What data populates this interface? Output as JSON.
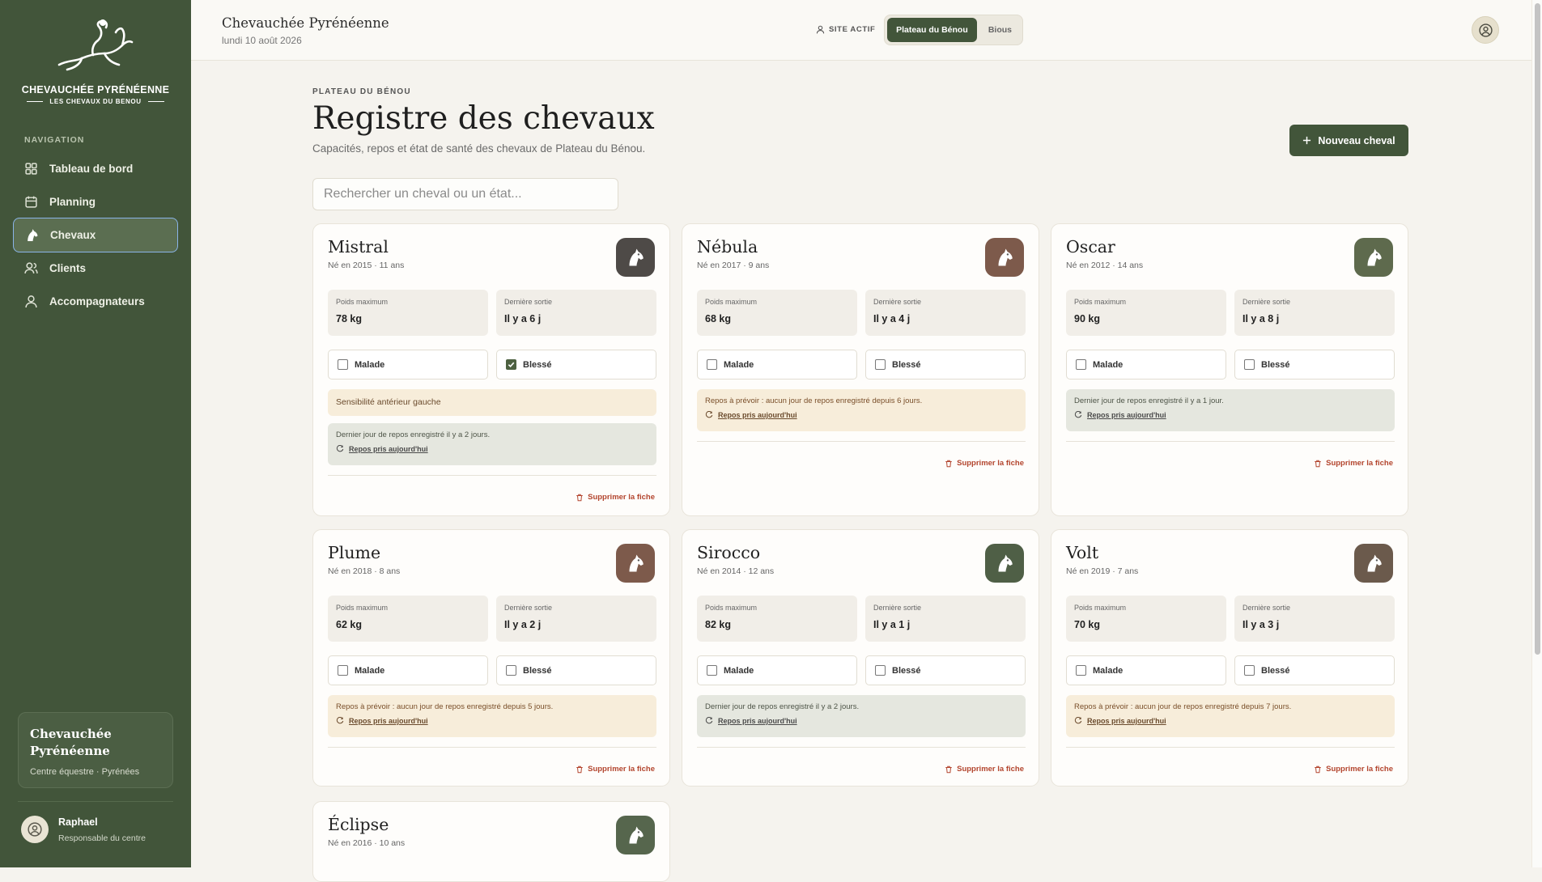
{
  "sidebar": {
    "brand": "CHEVAUCHÉE PYRÉNÉENNE",
    "brand_sub": "LES CHEVAUX DU BENOU",
    "nav_title": "NAVIGATION",
    "items": [
      {
        "label": "Tableau de bord",
        "icon": "dashboard-icon"
      },
      {
        "label": "Planning",
        "icon": "calendar-icon"
      },
      {
        "label": "Chevaux",
        "icon": "horse-icon",
        "active": true
      },
      {
        "label": "Clients",
        "icon": "users-icon"
      },
      {
        "label": "Accompagnateurs",
        "icon": "user-icon"
      }
    ],
    "center": {
      "name": "Chevauchée Pyrénéenne",
      "desc": "Centre équestre · Pyrénées"
    },
    "user": {
      "name": "Raphael",
      "role": "Responsable du centre"
    }
  },
  "topbar": {
    "title": "Chevauchée Pyrénéenne",
    "date": "lundi 10 août 2026",
    "site_label": "SITE ACTIF",
    "sites": [
      "Plateau du Bénou",
      "Bious"
    ],
    "active_site": "Plateau du Bénou"
  },
  "page": {
    "kicker": "PLATEAU DU BÉNOU",
    "title": "Registre des chevaux",
    "subtitle": "Capacités, repos et état de santé des chevaux de Plateau du Bénou.",
    "new_button": "Nouveau cheval",
    "search_placeholder": "Rechercher un cheval ou un état..."
  },
  "labels": {
    "max_weight": "Poids maximum",
    "last_outing": "Dernière sortie",
    "sick": "Malade",
    "injured": "Blessé",
    "rest_today": "Repos pris aujourd'hui",
    "delete": "Supprimer la fiche"
  },
  "colors": {
    "sidebar": "#42553a",
    "accent": "#42553a",
    "icon_green": "#505f48",
    "icon_brown": "#7d5a4b",
    "danger": "#b3452e"
  },
  "horses": [
    {
      "name": "Mistral",
      "born": "Né en 2015 · 11 ans",
      "icon_color": "#4e4a47",
      "max_weight": "78 kg",
      "last_outing": "Il y a 6 j",
      "sick": false,
      "injured": true,
      "note": "Sensibilité antérieur gauche",
      "rest_text": "Dernier jour de repos enregistré il y a 2 jours.",
      "rest_status": "ok"
    },
    {
      "name": "Nébula",
      "born": "Né en 2017 · 9 ans",
      "icon_color": "#7d5a4b",
      "max_weight": "68 kg",
      "last_outing": "Il y a 4 j",
      "sick": false,
      "injured": false,
      "note": "",
      "rest_text": "Repos à prévoir : aucun jour de repos enregistré depuis 6 jours.",
      "rest_status": "warn"
    },
    {
      "name": "Oscar",
      "born": "Né en 2012 · 14 ans",
      "icon_color": "#5e6a4d",
      "max_weight": "90 kg",
      "last_outing": "Il y a 8 j",
      "sick": false,
      "injured": false,
      "note": "",
      "rest_text": "Dernier jour de repos enregistré il y a 1 jour.",
      "rest_status": "ok"
    },
    {
      "name": "Plume",
      "born": "Né en 2018 · 8 ans",
      "icon_color": "#7d5a4b",
      "max_weight": "62 kg",
      "last_outing": "Il y a 2 j",
      "sick": false,
      "injured": false,
      "note": "",
      "rest_text": "Repos à prévoir : aucun jour de repos enregistré depuis 5 jours.",
      "rest_status": "warn"
    },
    {
      "name": "Sirocco",
      "born": "Né en 2014 · 12 ans",
      "icon_color": "#4f5f46",
      "max_weight": "82 kg",
      "last_outing": "Il y a 1 j",
      "sick": false,
      "injured": false,
      "note": "",
      "rest_text": "Dernier jour de repos enregistré il y a 2 jours.",
      "rest_status": "ok"
    },
    {
      "name": "Volt",
      "born": "Né en 2019 · 7 ans",
      "icon_color": "#6b5a4c",
      "max_weight": "70 kg",
      "last_outing": "Il y a 3 j",
      "sick": false,
      "injured": false,
      "note": "",
      "rest_text": "Repos à prévoir : aucun jour de repos enregistré depuis 7 jours.",
      "rest_status": "warn"
    },
    {
      "name": "Éclipse",
      "born": "Né en 2016 · 10 ans",
      "icon_color": "#56664d"
    }
  ]
}
